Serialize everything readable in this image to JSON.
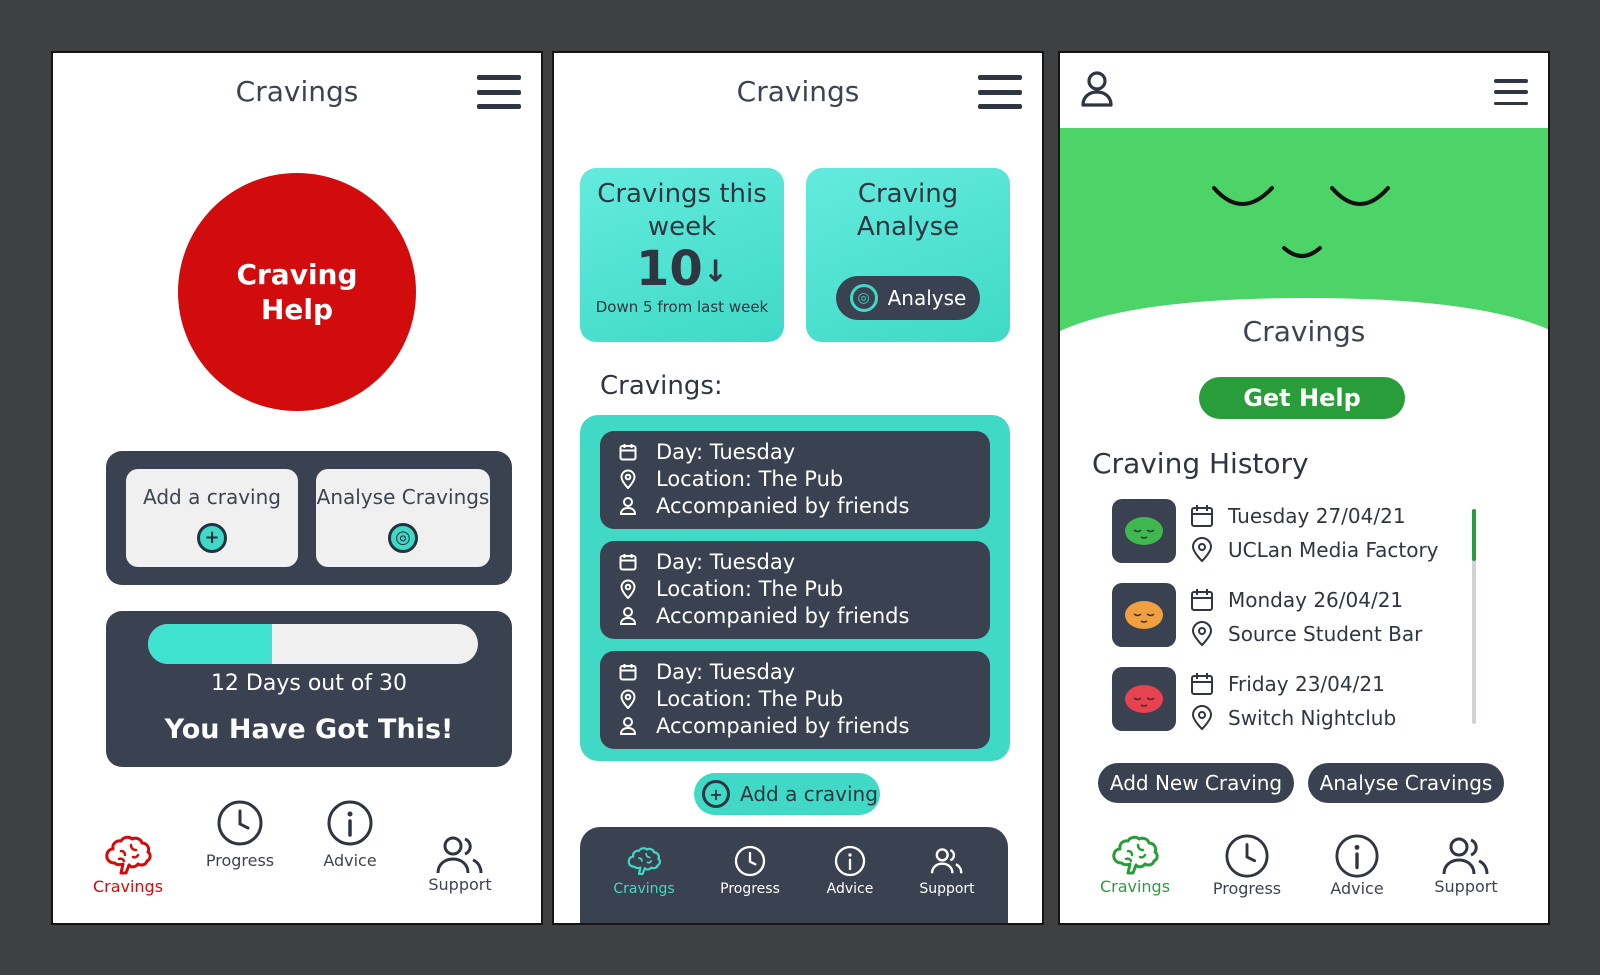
{
  "screen1": {
    "title": "Cravings",
    "craving_help": "Craving\nHelp",
    "add_craving": "Add a craving",
    "analyse_cravings": "Analyse Cravings",
    "progress_fraction": 0.375,
    "progress_text": "12 Days out of 30",
    "motivation": "You Have Got This!",
    "nav": {
      "cravings": "Cravings",
      "progress": "Progress",
      "advice": "Advice",
      "support": "Support"
    }
  },
  "screen2": {
    "title": "Cravings",
    "week_card": {
      "title": "Cravings this week",
      "count": "10",
      "arrow": "↓",
      "subtitle": "Down 5 from last week"
    },
    "analyse_card": {
      "title": "Craving Analyse",
      "button": "Analyse"
    },
    "list_heading": "Cravings:",
    "items": [
      {
        "day": "Day: Tuesday",
        "location": "Location: The Pub",
        "company": "Accompanied by friends"
      },
      {
        "day": "Day: Tuesday",
        "location": "Location: The Pub",
        "company": "Accompanied by friends"
      },
      {
        "day": "Day: Tuesday",
        "location": "Location: The Pub",
        "company": "Accompanied by friends"
      }
    ],
    "add_craving": "Add a craving",
    "nav": {
      "cravings": "Cravings",
      "progress": "Progress",
      "advice": "Advice",
      "support": "Support"
    }
  },
  "screen3": {
    "title": "Cravings",
    "get_help": "Get Help",
    "history_heading": "Craving History",
    "history": [
      {
        "date": "Tuesday 27/04/21",
        "place": "UCLan Media Factory",
        "mood_color": "#3fb84f"
      },
      {
        "date": "Monday 26/04/21",
        "place": "Source Student Bar",
        "mood_color": "#f0a040"
      },
      {
        "date": "Friday 23/04/21",
        "place": "Switch Nightclub",
        "mood_color": "#e8424e"
      }
    ],
    "add_new": "Add New Craving",
    "analyse": "Analyse Cravings",
    "nav": {
      "cravings": "Cravings",
      "progress": "Progress",
      "advice": "Advice",
      "support": "Support"
    }
  },
  "colors": {
    "red": "#d20c0c",
    "teal": "#3fd9c6",
    "dark": "#3a4252",
    "green": "#4dd468",
    "green_button": "#2a9d3b"
  },
  "icons": [
    "hamburger-icon",
    "plus-circle-icon",
    "analyse-icon",
    "calendar-icon",
    "location-icon",
    "person-icon",
    "brain-icon",
    "clock-icon",
    "info-icon",
    "people-icon",
    "user-icon",
    "down-arrow-icon"
  ]
}
